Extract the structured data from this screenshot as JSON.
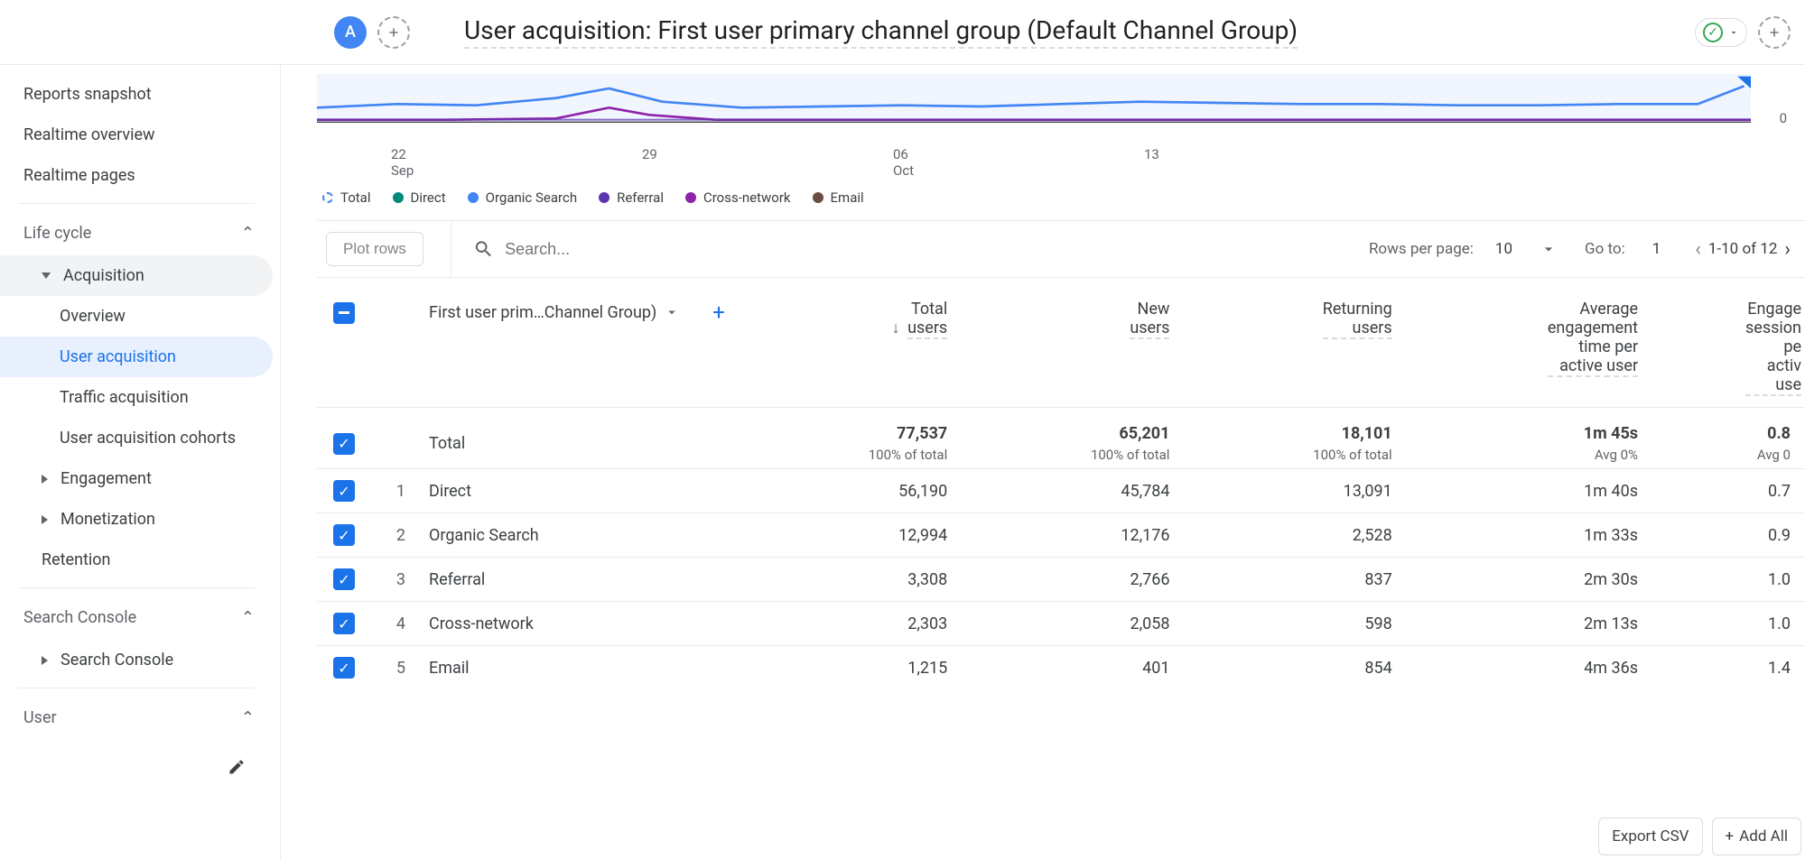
{
  "header": {
    "avatar_letter": "A",
    "title": "User acquisition: First user primary channel group (Default Channel Group)"
  },
  "sidebar": {
    "items": [
      {
        "label": "Reports snapshot"
      },
      {
        "label": "Realtime overview"
      },
      {
        "label": "Realtime pages"
      }
    ],
    "life_cycle": {
      "label": "Life cycle",
      "acquisition": {
        "label": "Acquisition",
        "children": [
          {
            "label": "Overview"
          },
          {
            "label": "User acquisition"
          },
          {
            "label": "Traffic acquisition"
          },
          {
            "label": "User acquisition cohorts"
          }
        ]
      },
      "engagement": {
        "label": "Engagement"
      },
      "monetization": {
        "label": "Monetization"
      },
      "retention": {
        "label": "Retention"
      }
    },
    "search_console": {
      "label": "Search Console",
      "child": {
        "label": "Search Console"
      }
    },
    "user": {
      "label": "User"
    }
  },
  "chart_data": {
    "type": "line",
    "x_ticks": [
      "22 Sep",
      "29",
      "06 Oct",
      "13"
    ],
    "y_right": "0",
    "series": [
      {
        "name": "Total",
        "color": "#4285f4",
        "dashed": true
      },
      {
        "name": "Direct",
        "color": "#00897b"
      },
      {
        "name": "Organic Search",
        "color": "#4285f4"
      },
      {
        "name": "Referral",
        "color": "#5e35b1"
      },
      {
        "name": "Cross-network",
        "color": "#8e24aa"
      },
      {
        "name": "Email",
        "color": "#6d4c41"
      }
    ]
  },
  "toolbar": {
    "plot_rows": "Plot rows",
    "search_placeholder": "Search...",
    "rows_per_page_label": "Rows per page:",
    "rows_per_page_value": "10",
    "go_to_label": "Go to:",
    "go_to_value": "1",
    "page_info": "1-10 of 12"
  },
  "table": {
    "dimension_label": "First user prim…Channel Group)",
    "columns": [
      {
        "label_line1": "Total",
        "label_line2": "users",
        "sorted": true
      },
      {
        "label_line1": "New",
        "label_line2": "users"
      },
      {
        "label_line1": "Returning",
        "label_line2": "users"
      },
      {
        "label_line1": "Average",
        "label_line2": "engagement",
        "label_line3": "time per",
        "label_line4": "active user"
      },
      {
        "label_line1": "Engage",
        "label_line2": "session",
        "label_line3": "pe",
        "label_line4": "activ",
        "label_line5": "use"
      }
    ],
    "totals": {
      "name": "Total",
      "cells": [
        {
          "value": "77,537",
          "sub": "100% of total"
        },
        {
          "value": "65,201",
          "sub": "100% of total"
        },
        {
          "value": "18,101",
          "sub": "100% of total"
        },
        {
          "value": "1m 45s",
          "sub": "Avg 0%"
        },
        {
          "value": "0.8",
          "sub": "Avg 0"
        }
      ]
    },
    "rows": [
      {
        "idx": "1",
        "name": "Direct",
        "cells": [
          "56,190",
          "45,784",
          "13,091",
          "1m 40s",
          "0.7"
        ]
      },
      {
        "idx": "2",
        "name": "Organic Search",
        "cells": [
          "12,994",
          "12,176",
          "2,528",
          "1m 33s",
          "0.9"
        ]
      },
      {
        "idx": "3",
        "name": "Referral",
        "cells": [
          "3,308",
          "2,766",
          "837",
          "2m 30s",
          "1.0"
        ]
      },
      {
        "idx": "4",
        "name": "Cross-network",
        "cells": [
          "2,303",
          "2,058",
          "598",
          "2m 13s",
          "1.0"
        ]
      },
      {
        "idx": "5",
        "name": "Email",
        "cells": [
          "1,215",
          "401",
          "854",
          "4m 36s",
          "1.4"
        ]
      }
    ]
  },
  "footer": {
    "export": "Export CSV",
    "add_all": "Add All"
  }
}
